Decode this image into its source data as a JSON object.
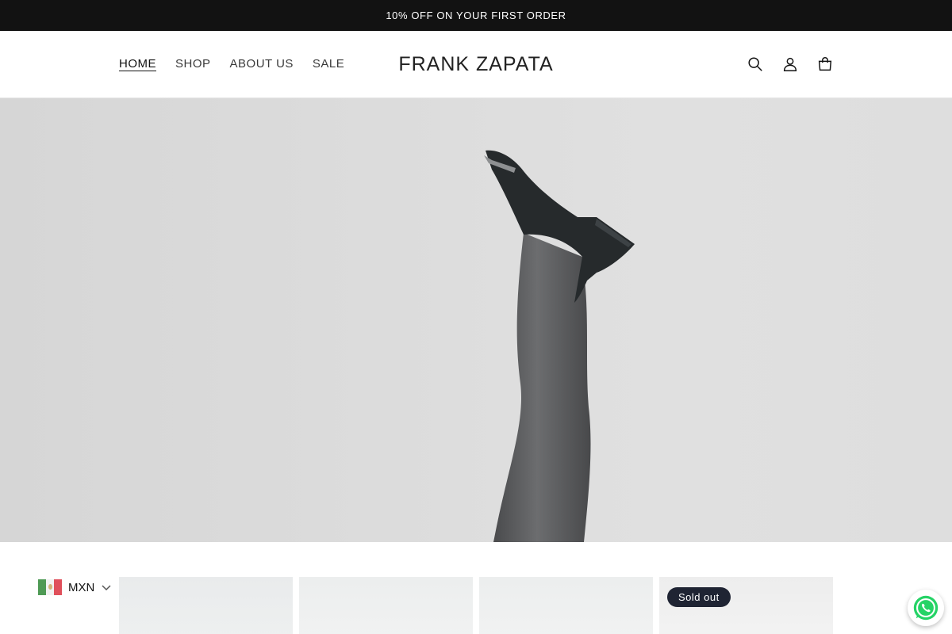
{
  "announcement": {
    "text": "10% OFF ON YOUR FIRST ORDER"
  },
  "header": {
    "nav": [
      {
        "label": "HOME",
        "active": true
      },
      {
        "label": "SHOP",
        "active": false
      },
      {
        "label": "ABOUT US",
        "active": false
      },
      {
        "label": "SALE",
        "active": false
      }
    ],
    "logo": "FRANK ZAPATA",
    "icons": [
      "search-icon",
      "account-icon",
      "cart-icon"
    ]
  },
  "hero": {
    "image": "leg-with-black-heel-against-grey-wall"
  },
  "currency": {
    "code": "MXN",
    "flag": "mexico-flag-icon"
  },
  "products": [
    {
      "badge": ""
    },
    {
      "badge": ""
    },
    {
      "badge": ""
    },
    {
      "badge": "Sold out"
    }
  ],
  "colors": {
    "announcement_bg": "#121212",
    "badge_bg": "#1f2433",
    "whatsapp_green": "#25d366"
  }
}
